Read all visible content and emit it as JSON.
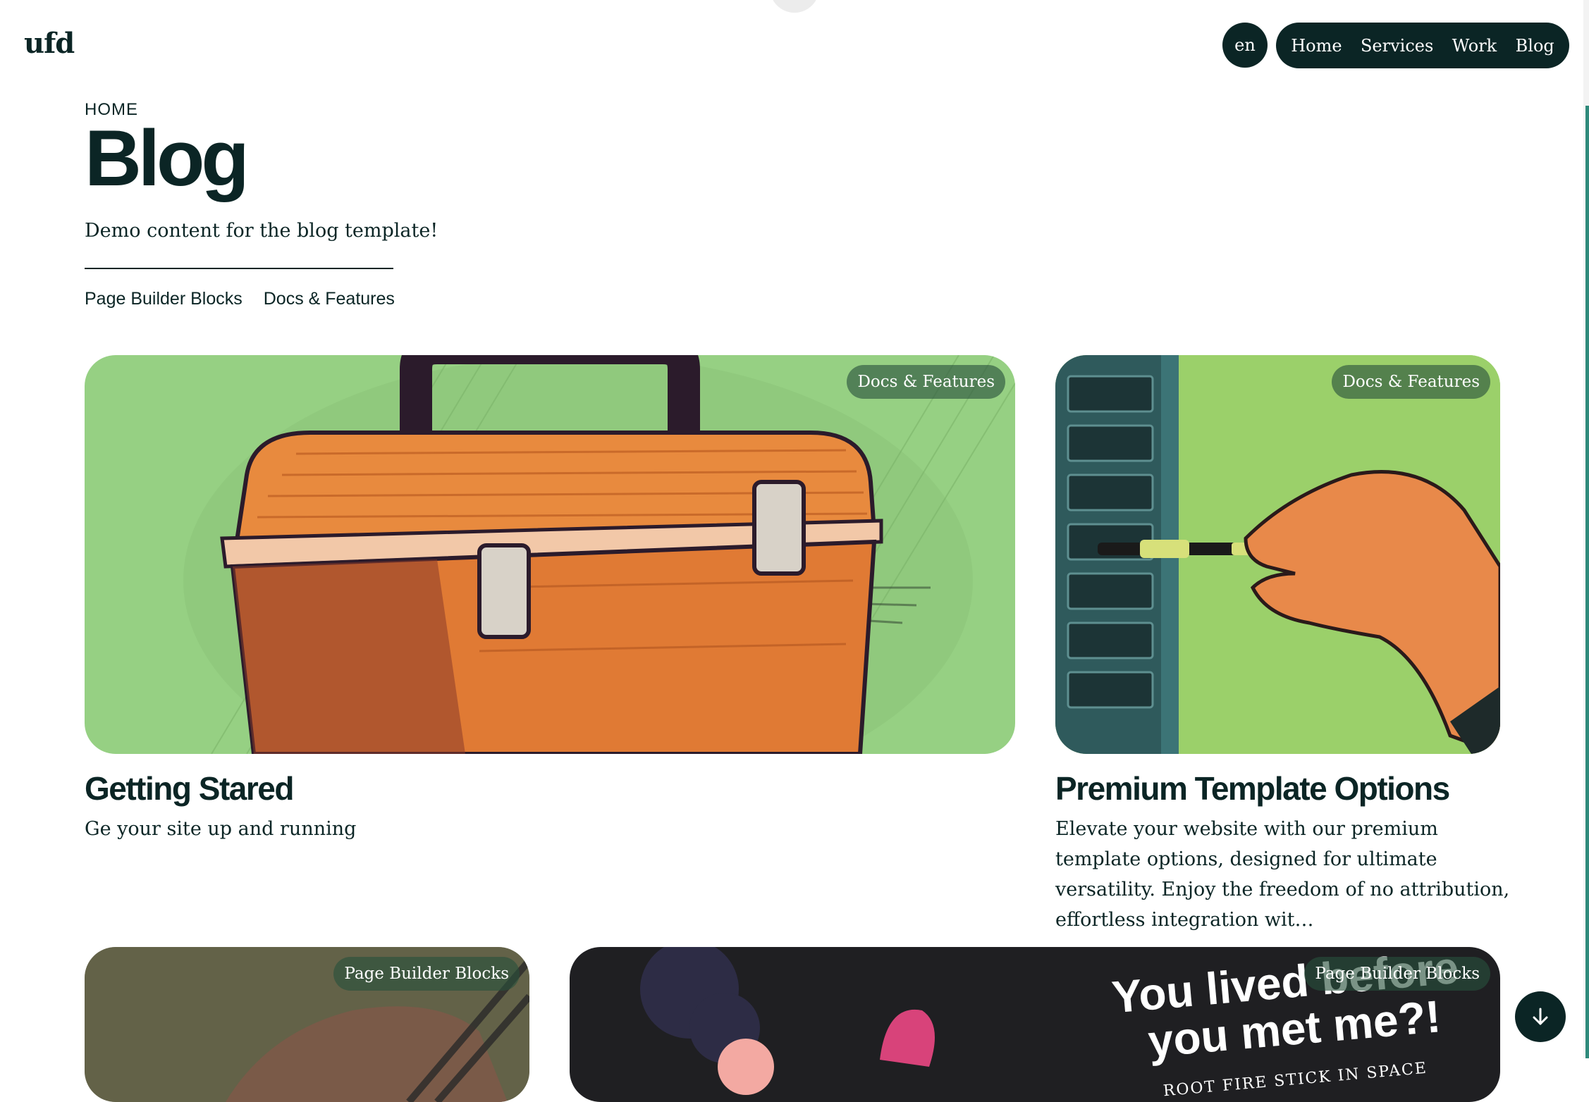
{
  "header": {
    "logo": "ufd",
    "language": "en",
    "nav": [
      "Home",
      "Services",
      "Work",
      "Blog"
    ]
  },
  "page": {
    "breadcrumb": "HOME",
    "title": "Blog",
    "description": "Demo content for the blog template!",
    "categories": [
      "Page Builder Blocks",
      "Docs & Features"
    ]
  },
  "posts": [
    {
      "badge": "Docs & Features",
      "title": "Getting Stared",
      "excerpt": "Ge your site up and running"
    },
    {
      "badge": "Docs & Features",
      "title": "Premium Template Options",
      "excerpt": "Elevate your website with our premium template options, designed for ultimate versatility. Enjoy the freedom of no attribution, effortless integration wit…"
    },
    {
      "badge": "Page Builder Blocks"
    },
    {
      "badge": "Page Builder Blocks",
      "image_text_line1": "You lived before",
      "image_text_line2": "you met me?!",
      "image_small_text": "ROOT FIRE STICK IN SPACE"
    }
  ],
  "colors": {
    "ink": "#0b2525",
    "accent": "#2f8a7b",
    "card_green": "#96d083",
    "toolbox_orange": "#e8843c"
  },
  "icons": {
    "scroll_down": "arrow-down-icon"
  }
}
